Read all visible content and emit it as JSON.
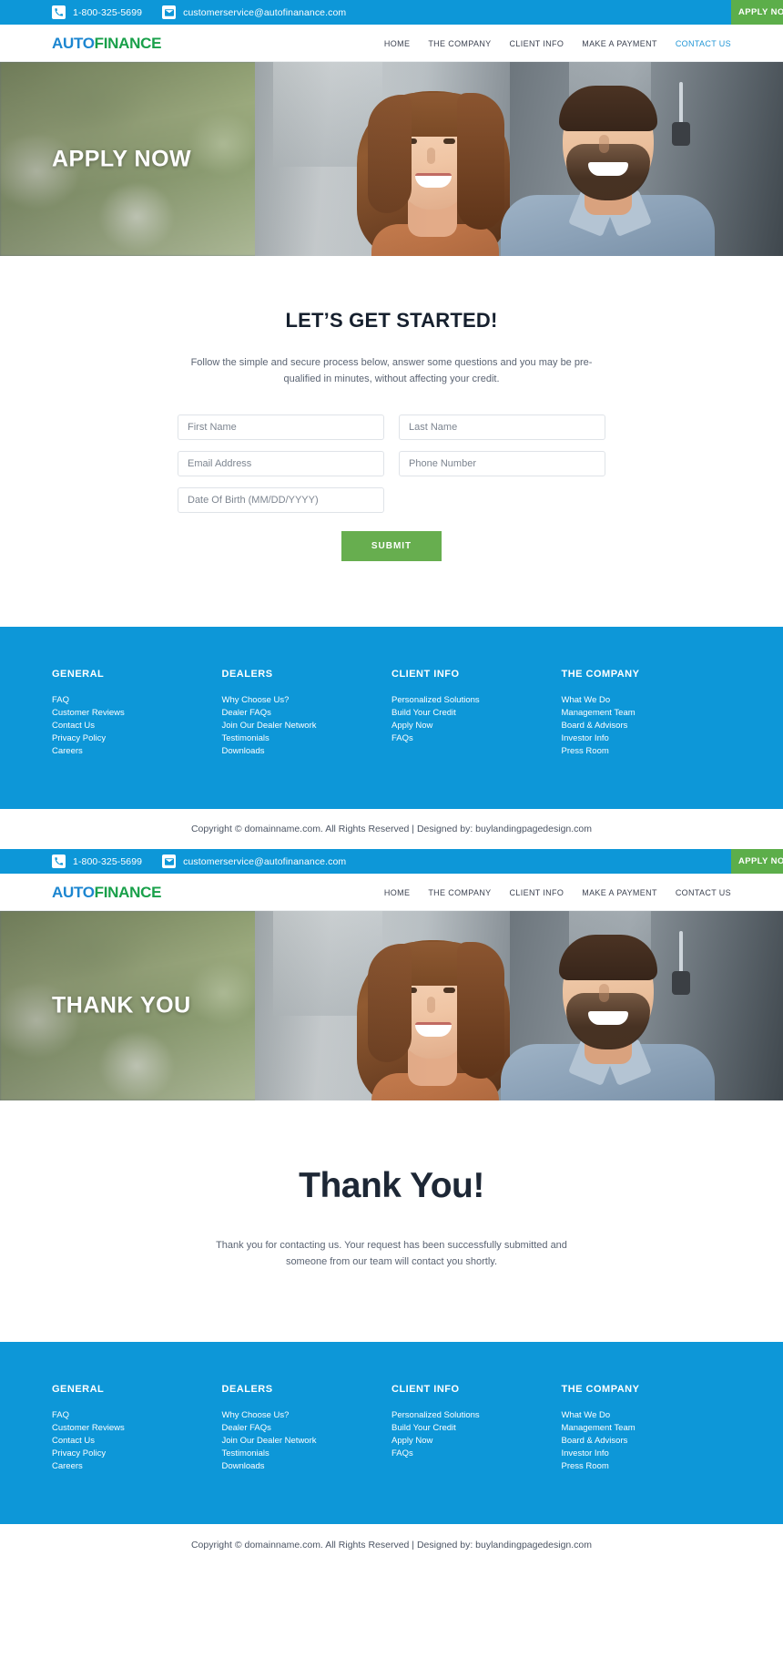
{
  "topbar": {
    "phone": "1-800-325-5699",
    "email": "customerservice@autofinanance.com",
    "apply_label": "APPLY NOW",
    "phone_icon": "phone-icon",
    "email_icon": "envelope-icon",
    "bg_color": "#0d97d8",
    "apply_bg_color": "#5cae4a"
  },
  "nav": {
    "logo_part1": "AUTO",
    "logo_part2": "FINANCE",
    "logo_color1": "#1c86d0",
    "logo_color2": "#19a04a",
    "links": [
      {
        "label": "HOME",
        "active": false
      },
      {
        "label": "THE COMPANY",
        "active": false
      },
      {
        "label": "CLIENT INFO",
        "active": false
      },
      {
        "label": "MAKE A PAYMENT",
        "active": false
      },
      {
        "label": "CONTACT US",
        "active": true
      }
    ],
    "links2": [
      {
        "label": "HOME",
        "active": false
      },
      {
        "label": "THE COMPANY",
        "active": false
      },
      {
        "label": "CLIENT INFO",
        "active": false
      },
      {
        "label": "MAKE A PAYMENT",
        "active": false
      },
      {
        "label": "CONTACT US",
        "active": false
      }
    ]
  },
  "hero1": {
    "title": "APPLY NOW"
  },
  "hero2": {
    "title": "THANK YOU"
  },
  "form": {
    "heading": "LET’S GET STARTED!",
    "subheading": "Follow the simple and secure process below, answer some questions and you may be pre-qualified in minutes, without affecting your credit.",
    "fields": {
      "first_name": "First Name",
      "last_name": "Last Name",
      "email": "Email Address",
      "phone": "Phone Number",
      "dob": "Date Of Birth (MM/DD/YYYY)"
    },
    "values": {
      "first_name": "",
      "last_name": "",
      "email": "",
      "phone": "",
      "dob": ""
    },
    "submit_label": "SUBMIT",
    "submit_color": "#67ae4f"
  },
  "thanks": {
    "heading": "Thank You!",
    "body": "Thank you for contacting us. Your request has been successfully submitted and someone from our team will contact you shortly."
  },
  "footer": {
    "bg_color": "#0d97d8",
    "columns": [
      {
        "title": "GENERAL",
        "links": [
          "FAQ",
          "Customer Reviews",
          "Contact Us",
          "Privacy Policy",
          "Careers"
        ]
      },
      {
        "title": "DEALERS",
        "links": [
          "Why Choose Us?",
          "Dealer FAQs",
          "Join Our Dealer Network",
          "Testimonials",
          "Downloads"
        ]
      },
      {
        "title": "CLIENT INFO",
        "links": [
          "Personalized Solutions",
          "Build Your Credit",
          "Apply Now",
          "FAQs"
        ]
      },
      {
        "title": "THE COMPANY",
        "links": [
          "What We Do",
          "Management Team",
          "Board & Advisors",
          "Investor Info",
          "Press Room"
        ]
      }
    ],
    "copyright": "Copyright © domainname.com. All Rights Reserved | Designed by: buylandingpagedesign.com"
  }
}
